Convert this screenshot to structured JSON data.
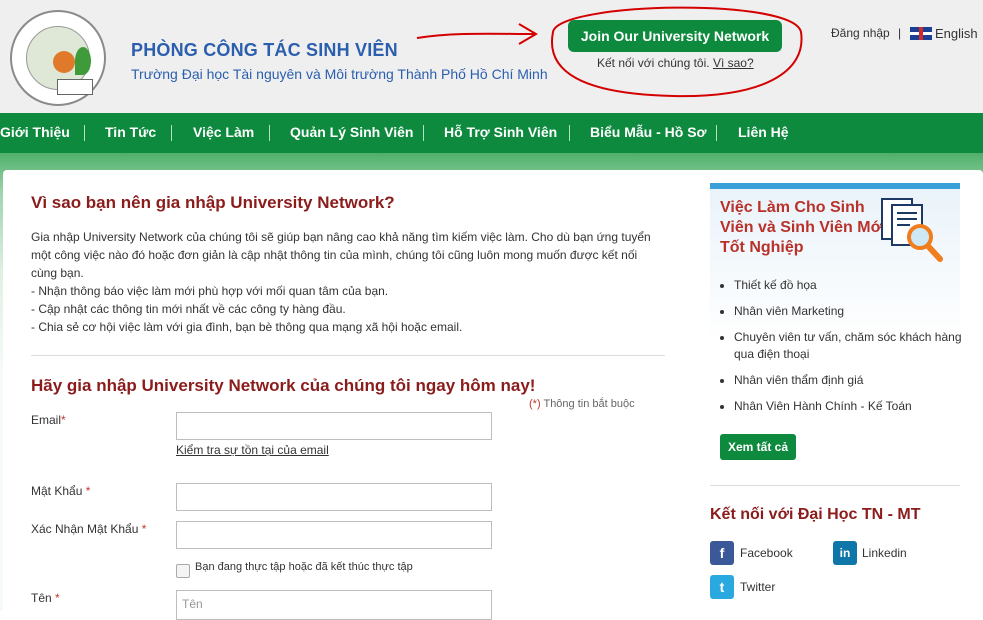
{
  "header": {
    "title": "PHÒNG CÔNG TÁC SINH VIÊN",
    "subtitle": "Trường Đại học Tài nguyên và Môi trường Thành Phố Hồ Chí Minh",
    "logo_name": "university-logo",
    "join_button": "Join Our University Network",
    "connect_text": "Kết nối với chúng tôi.",
    "why_link": "Vì sao?",
    "login": "Đăng nhập",
    "separator": "|",
    "language": "English"
  },
  "nav": {
    "items": [
      "Giới Thiệu",
      "Tin Tức",
      "Việc Làm",
      "Quản Lý Sinh Viên",
      "Hỗ Trợ Sinh Viên",
      "Biểu Mẫu - Hồ Sơ",
      "Liên Hệ"
    ]
  },
  "main": {
    "why_heading": "Vì sao bạn nên gia nhập University Network?",
    "paragraph": "Gia nhập University Network của chúng tôi sẽ giúp bạn nâng cao khả năng tìm kiếm việc làm. Cho dù bạn ứng tuyển một công việc nào đó hoặc đơn giản là cập nhật thông tin của mình, chúng tôi cũng luôn mong muốn được kết nối cùng bạn.",
    "bullets": [
      "- Nhận thông báo việc làm mới phù hợp với mối quan tâm của bạn.",
      "- Cập nhật các thông tin mới nhất về các công ty hàng đầu.",
      "- Chia sẻ cơ hội việc làm với gia đình, bạn bè thông qua mạng xã hội hoặc email."
    ],
    "join_heading": "Hãy gia nhập University Network của chúng tôi ngay hôm nay!",
    "required_star": "(*)",
    "required_note": "Thông tin bắt buộc"
  },
  "form": {
    "email_label": "Email",
    "email_value": "",
    "check_email": "Kiểm tra sự tồn tại của email",
    "password_label": "Mật Khẩu",
    "password_value": "",
    "confirm_label": "Xác Nhận Mật Khẩu",
    "confirm_value": "",
    "intern_checkbox": "Bạn đang thực tập hoặc đã kết thúc thực tập",
    "intern_checked": false,
    "name_label": "Tên",
    "name_placeholder": "Tên",
    "star": "*"
  },
  "sidebar": {
    "jobs_title": "Việc Làm Cho Sinh Viên và Sinh Viên Mới Tốt Nghiệp",
    "jobs": [
      "Thiết kế đồ họa",
      "Nhân viên Marketing",
      "Chuyên viên tư vấn, chăm sóc khách hàng qua điện thoại",
      "Nhân viên thẩm định giá",
      "Nhân Viên Hành Chính - Kế Toán"
    ],
    "view_all": "Xem tất cả",
    "connect_heading": "Kết nối với Đại Học TN - MT",
    "social": [
      {
        "name": "Facebook",
        "icon": "facebook-icon",
        "color": "#3b5998"
      },
      {
        "name": "Linkedin",
        "icon": "linkedin-icon",
        "color": "#0e76a8"
      },
      {
        "name": "Twitter",
        "icon": "twitter-icon",
        "color": "#2aa9e0"
      }
    ]
  },
  "colors": {
    "brand_green": "#0e8a3e",
    "heading_red": "#8b1c1c",
    "title_blue": "#2b5fae",
    "annotation_red": "#d40000"
  }
}
